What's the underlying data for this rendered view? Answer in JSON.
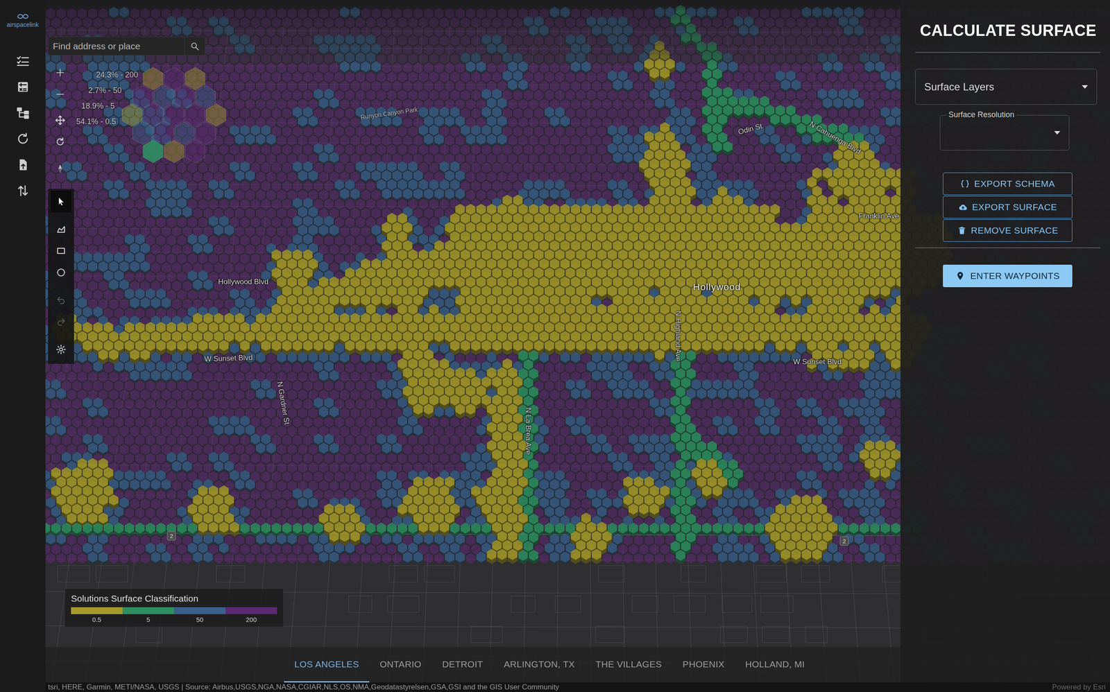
{
  "logo": {
    "text": "airspacelink"
  },
  "sidebar": {
    "items": [
      {
        "kind": "checklist"
      },
      {
        "kind": "calculator"
      },
      {
        "kind": "hierarchy"
      },
      {
        "kind": "refresh"
      },
      {
        "kind": "upload"
      },
      {
        "kind": "sort"
      }
    ]
  },
  "search": {
    "placeholder": "Find address or place"
  },
  "map_nav": [
    {
      "kind": "plus"
    },
    {
      "kind": "minus"
    },
    {
      "kind": "pan"
    },
    {
      "kind": "rotate"
    },
    {
      "kind": "compass"
    }
  ],
  "map_tools": [
    {
      "kind": "select",
      "selected": true,
      "disabled": false
    },
    {
      "kind": "polygon",
      "selected": false,
      "disabled": false
    },
    {
      "kind": "rectangle",
      "selected": false,
      "disabled": false
    },
    {
      "kind": "circle",
      "selected": false,
      "disabled": false
    },
    {
      "kind": "undo",
      "selected": false,
      "disabled": true
    },
    {
      "kind": "redo",
      "selected": false,
      "disabled": true
    },
    {
      "kind": "settings",
      "selected": false,
      "disabled": false
    }
  ],
  "hex_legend": {
    "items": [
      {
        "label": "24.3% - 200",
        "color": "#5b2a70"
      },
      {
        "label": "2.7% - 50",
        "color": "#3b6089"
      },
      {
        "label": "18.9% - 5",
        "color": "#2f8f63"
      },
      {
        "label": "54.1% - 0.5",
        "color": "#a59a2c"
      }
    ]
  },
  "map_labels": [
    {
      "text": "Runyon Canyon Park",
      "kind": "park"
    },
    {
      "text": "Hollywood Blvd",
      "kind": "street"
    },
    {
      "text": "W Sunset Blvd",
      "kind": "street"
    },
    {
      "text": "Hollywood",
      "kind": "place"
    },
    {
      "text": "N Highland Ave",
      "kind": "street"
    },
    {
      "text": "N La Brea Ave",
      "kind": "street"
    },
    {
      "text": "N Gardner St",
      "kind": "street"
    },
    {
      "text": "W Sunset Blvd",
      "kind": "street"
    },
    {
      "text": "Franklin Ave",
      "kind": "street"
    },
    {
      "text": "N Cahuenga Blvd",
      "kind": "street"
    },
    {
      "text": "Odin St",
      "kind": "street"
    },
    {
      "text": "2",
      "kind": "shield"
    },
    {
      "text": "2",
      "kind": "shield"
    }
  ],
  "surface_legend": {
    "title": "Solutions Surface Classification",
    "classes": [
      {
        "label": "0.5",
        "color": "#a59a2c"
      },
      {
        "label": "5",
        "color": "#2f8f63"
      },
      {
        "label": "50",
        "color": "#3b6089"
      },
      {
        "label": "200",
        "color": "#5b2a70"
      }
    ]
  },
  "panel": {
    "title": "CALCULATE SURFACE",
    "surface_layers": {
      "value": "Surface Layers"
    },
    "surface_resolution": {
      "label": "Surface Resolution"
    },
    "buttons": [
      {
        "label": "EXPORT SCHEMA",
        "kind": "schema"
      },
      {
        "label": "EXPORT SURFACE",
        "kind": "cloud"
      },
      {
        "label": "REMOVE SURFACE",
        "kind": "trash"
      }
    ],
    "primary_button": {
      "label": "ENTER WAYPOINTS"
    }
  },
  "tabs": [
    {
      "label": "LOS ANGELES",
      "selected": true
    },
    {
      "label": "ONTARIO",
      "selected": false
    },
    {
      "label": "DETROIT",
      "selected": false
    },
    {
      "label": "ARLINGTON, TX",
      "selected": false
    },
    {
      "label": "THE VILLAGES",
      "selected": false
    },
    {
      "label": "PHOENIX",
      "selected": false
    },
    {
      "label": "HOLLAND, MI",
      "selected": false
    }
  ],
  "attribution": {
    "text": "tsri, HERE, Garmin, METI/NASA, USGS | Source: Airbus,USGS,NGA,NASA,CGIAR,NLS,OS,NMA,Geodatastyrelsen,GSA,GSI and the GIS User Community",
    "powered_by": "Powered by Esri"
  }
}
